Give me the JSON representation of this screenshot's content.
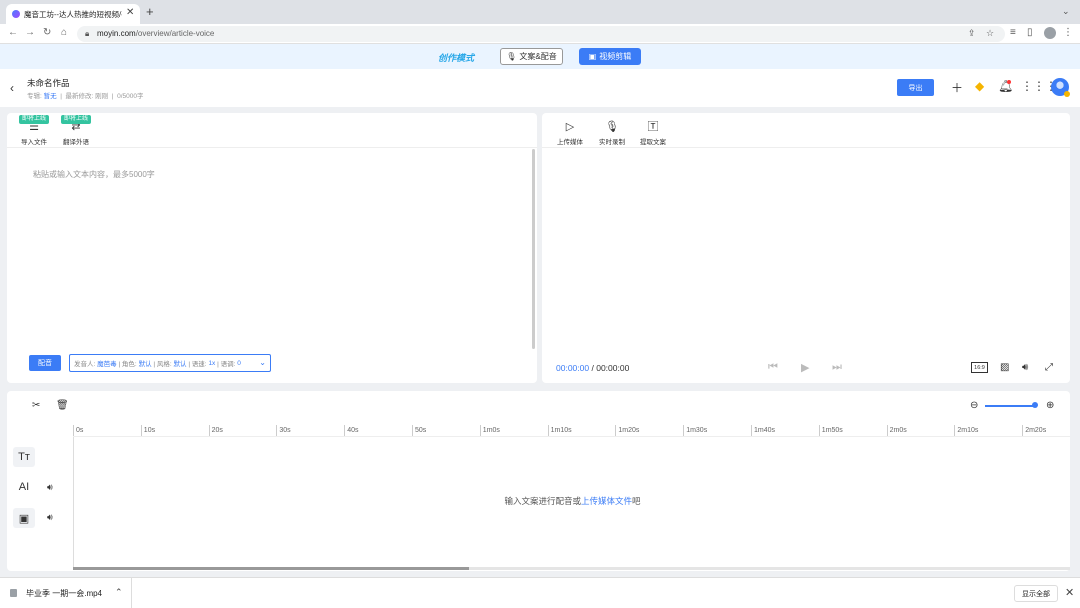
{
  "browser": {
    "tab_title": "魔音工坊--达人热推的短视频/有",
    "tab_close": "✕",
    "new_tab": "+",
    "url_host": "moyin.com",
    "url_path": "/overview/article-voice"
  },
  "modebar": {
    "mode_label": "创作模式",
    "btn_copy_dub": "文案&配音",
    "btn_video_edit": "视频剪辑"
  },
  "header": {
    "project_title": "未命名作品",
    "meta_album_label": "专辑:",
    "meta_album_value": "暂无",
    "meta_modified_label": "最新修改:",
    "meta_modified_value": "刚刚",
    "meta_count": "0/5000字",
    "export_label": "导出"
  },
  "left_panel": {
    "tool_import_label": "导入文件",
    "tool_import_badge": "即将上线",
    "tool_translate_label": "翻译外语",
    "tool_translate_badge": "即将上线",
    "placeholder": "粘贴或输入文本内容，最多5000字",
    "dub_button": "配音",
    "settings": {
      "speaker_label": "发音人:",
      "speaker_value": "魔芭毒",
      "role_label": "| 角色:",
      "role_value": "默认",
      "style_label": "| 风格:",
      "style_value": "默认",
      "speed_label": "| 语速:",
      "speed_value": "1x",
      "pitch_label": "| 语调:",
      "pitch_value": "0"
    }
  },
  "right_panel": {
    "tool_upload_label": "上传媒体",
    "tool_record_label": "实时录制",
    "tool_extract_label": "提取文案",
    "time_current": "00:00:00",
    "time_sep": "/",
    "time_total": "00:00:00",
    "ratio_label": "16:9"
  },
  "timeline": {
    "ticks": [
      "0s",
      "10s",
      "20s",
      "30s",
      "40s",
      "50s",
      "1m0s",
      "1m10s",
      "1m20s",
      "1m30s",
      "1m40s",
      "1m50s",
      "2m0s",
      "2m10s",
      "2m20s"
    ],
    "text_track_icon": "Tт",
    "ai_track_icon": "AI",
    "empty_prefix": "输入文案进行配音或",
    "empty_link": "上传媒体文件",
    "empty_suffix": "吧"
  },
  "downloads": {
    "file_name": "毕业季 一期一会.mp4",
    "show_all": "显示全部"
  }
}
